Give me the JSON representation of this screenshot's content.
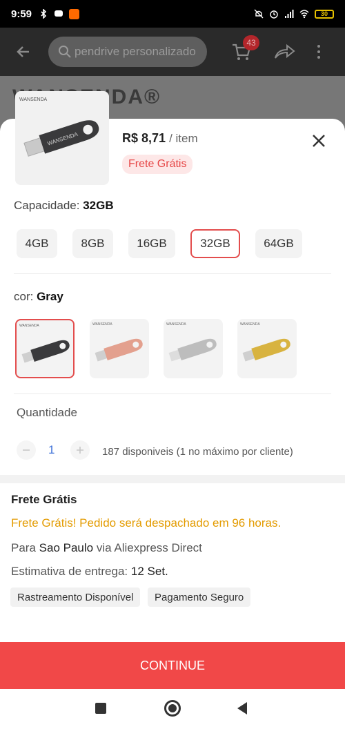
{
  "status_bar": {
    "time": "9:59",
    "battery": "30"
  },
  "app_bar": {
    "search_placeholder": "pendrive personalizado",
    "cart_count": "43"
  },
  "background": {
    "brand_text": "WANSENDA®"
  },
  "product": {
    "price": "R$ 8,71",
    "per_item": "/ item",
    "shipping_tag": "Frete Grátis"
  },
  "capacity": {
    "label": "Capacidade:",
    "selected": "32GB",
    "options": [
      "4GB",
      "8GB",
      "16GB",
      "32GB",
      "64GB"
    ]
  },
  "color": {
    "label": "cor:",
    "selected": "Gray",
    "options": [
      {
        "name": "Gray",
        "hex": "#3a3a3c"
      },
      {
        "name": "Rose Gold",
        "hex": "#e3a08e"
      },
      {
        "name": "Silver",
        "hex": "#bdbdbd"
      },
      {
        "name": "Gold",
        "hex": "#d8b340"
      }
    ],
    "accent": "#e34d4d"
  },
  "quantity": {
    "label": "Quantidade",
    "value": "1",
    "stock_text": "187 disponiveis (1 no máximo por cliente)"
  },
  "shipping": {
    "title": "Frete Grátis",
    "promo": "Frete Grátis! Pedido será despachado em 96 horas.",
    "to_prefix": "Para",
    "city": "Sao Paulo",
    "via": "via Aliexpress Direct",
    "estimate_label": "Estimativa de entrega:",
    "estimate_date": "12 Set.",
    "chips": [
      "Rastreamento Disponível",
      "Pagamento Seguro"
    ]
  },
  "continue_label": "CONTINUE",
  "colors": {
    "primary": "#f14848",
    "promo": "#e39b00",
    "qty": "#3b6fd8"
  }
}
